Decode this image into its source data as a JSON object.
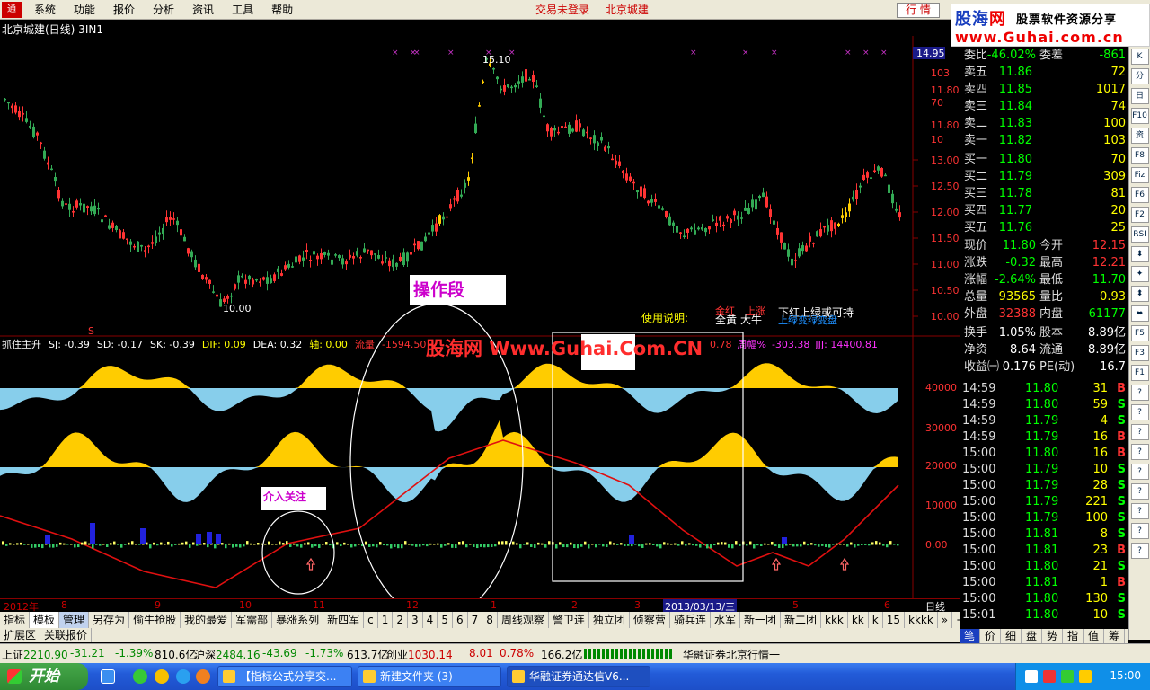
{
  "menu": {
    "logo_text": "通",
    "items": [
      "系统",
      "功能",
      "报价",
      "分析",
      "资讯",
      "工具",
      "帮助"
    ],
    "status_left": "交易未登录",
    "status_right": "北京城建",
    "market_btn": "行 情"
  },
  "brand": {
    "name_a": "股海",
    "name_b": "网",
    "slogan": "股票软件资源分享",
    "url": "www.Guhai.com.cn"
  },
  "chart": {
    "title": "北京城建(日线) 3IN1",
    "high_label": "15.10",
    "low_label": "10.00",
    "signal_s": "S",
    "price_ticks": [
      "13.00",
      "12.50",
      "12.00",
      "11.50",
      "11.00",
      "10.50",
      "10.00"
    ],
    "price_box": "14.95",
    "vol_ticks": [
      "40000",
      "30000",
      "20000",
      "10000",
      "0.00"
    ],
    "indicator_line": [
      {
        "text": "抓住主升",
        "color": "#ffffff"
      },
      {
        "text": "SJ: -0.39",
        "color": "#ffffff"
      },
      {
        "text": "SD: -0.17",
        "color": "#ffffff"
      },
      {
        "text": "SK: -0.39",
        "color": "#ffffff"
      },
      {
        "text": "DIF: 0.09",
        "color": "#ffff00"
      },
      {
        "text": "DEA: 0.32",
        "color": "#ffffff"
      },
      {
        "text": "轴: 0.00",
        "color": "#ffff00"
      },
      {
        "text": "流量",
        "color": "#ff3333"
      },
      {
        "text": "-1594.50",
        "color": "#ff3333"
      }
    ],
    "indicator_tail": [
      {
        "text": "0.78",
        "color": "#ff3333"
      },
      {
        "text": "周幅%",
        "color": "#ff33ff"
      },
      {
        "text": "-303.38",
        "color": "#ff33ff"
      },
      {
        "text": "JJJ: 14400.81",
        "color": "#ff33ff"
      }
    ],
    "usage_label": "使用说明:",
    "usage_tokens": [
      "金红",
      "上涨",
      "全黄",
      "大牛"
    ],
    "usage_note1": "下红上绿或可持",
    "usage_note2": "上绿变绿变盘"
  },
  "overlays": {
    "watermark": "股海网 Www.Guhai.Com.CN",
    "op_segment": "操作段",
    "attention": "介入关注",
    "no_op": "不做"
  },
  "date_axis": {
    "year": "2012年",
    "months": [
      "8",
      "9",
      "10",
      "11",
      "12",
      "1",
      "2",
      "3",
      "5",
      "6"
    ],
    "selected_date": "2013/03/13/三",
    "period": "日线"
  },
  "tabs": [
    "指标",
    "模板",
    "管理",
    "另存为",
    "偷牛抢股",
    "我的最爱",
    "军需部",
    "暴涨系列",
    "新四军",
    "c",
    "1",
    "2",
    "3",
    "4",
    "5",
    "6",
    "7",
    "8",
    "周线观察",
    "警卫连",
    "独立团",
    "侦察营",
    "骑兵连",
    "水军",
    "新一团",
    "新二团",
    "kkk",
    "kk",
    "k",
    "15",
    "kkkk",
    "»",
    "+",
    "-",
    "0"
  ],
  "subtabs": [
    "扩展区",
    "关联报价"
  ],
  "quote": {
    "ratio_label": "委比",
    "ratio_value": "-46.02%",
    "diff_label": "委差",
    "diff_value": "-861",
    "asks": [
      {
        "label": "卖五",
        "price": "11.86",
        "vol": "72"
      },
      {
        "label": "卖四",
        "price": "11.85",
        "vol": "1017"
      },
      {
        "label": "卖三",
        "price": "11.84",
        "vol": "74"
      },
      {
        "label": "卖二",
        "price": "11.83",
        "vol": "100"
      },
      {
        "label": "卖一",
        "price": "11.82",
        "vol": "103"
      }
    ],
    "bids": [
      {
        "label": "买一",
        "price": "11.80",
        "vol": "70"
      },
      {
        "label": "买二",
        "price": "11.79",
        "vol": "309"
      },
      {
        "label": "买三",
        "price": "11.78",
        "vol": "81"
      },
      {
        "label": "买四",
        "price": "11.77",
        "vol": "20"
      },
      {
        "label": "买五",
        "price": "11.76",
        "vol": "25"
      }
    ],
    "stats": [
      {
        "l1": "现价",
        "v1": "11.80",
        "c1": "#00ff00",
        "l2": "今开",
        "v2": "12.15",
        "c2": "#ff3333"
      },
      {
        "l1": "涨跌",
        "v1": "-0.32",
        "c1": "#00ff00",
        "l2": "最高",
        "v2": "12.21",
        "c2": "#ff3333"
      },
      {
        "l1": "涨幅",
        "v1": "-2.64%",
        "c1": "#00ff00",
        "l2": "最低",
        "v2": "11.70",
        "c2": "#00ff00"
      },
      {
        "l1": "总量",
        "v1": "93565",
        "c1": "#ffff00",
        "l2": "量比",
        "v2": "0.93",
        "c2": "#ffff00"
      },
      {
        "l1": "外盘",
        "v1": "32388",
        "c1": "#ff3333",
        "l2": "内盘",
        "v2": "61177",
        "c2": "#00ff00"
      },
      {
        "l1": "换手",
        "v1": "1.05%",
        "c1": "#ffffff",
        "l2": "股本",
        "v2": "8.89亿",
        "c2": "#ffffff"
      },
      {
        "l1": "净资",
        "v1": "8.64",
        "c1": "#ffffff",
        "l2": "流通",
        "v2": "8.89亿",
        "c2": "#ffffff"
      },
      {
        "l1": "收益㈠",
        "v1": "0.176",
        "c1": "#ffffff",
        "l2": "PE(动)",
        "v2": "16.7",
        "c2": "#ffffff"
      }
    ],
    "ticks": [
      {
        "t": "14:59",
        "p": "11.80",
        "v": "31",
        "f": "B"
      },
      {
        "t": "14:59",
        "p": "11.80",
        "v": "59",
        "f": "S"
      },
      {
        "t": "14:59",
        "p": "11.79",
        "v": "4",
        "f": "S"
      },
      {
        "t": "14:59",
        "p": "11.79",
        "v": "16",
        "f": "B"
      },
      {
        "t": "15:00",
        "p": "11.80",
        "v": "16",
        "f": "B"
      },
      {
        "t": "15:00",
        "p": "11.79",
        "v": "10",
        "f": "S"
      },
      {
        "t": "15:00",
        "p": "11.79",
        "v": "28",
        "f": "S"
      },
      {
        "t": "15:00",
        "p": "11.79",
        "v": "221",
        "f": "S"
      },
      {
        "t": "15:00",
        "p": "11.79",
        "v": "100",
        "f": "S"
      },
      {
        "t": "15:00",
        "p": "11.81",
        "v": "8",
        "f": "S"
      },
      {
        "t": "15:00",
        "p": "11.81",
        "v": "23",
        "f": "B"
      },
      {
        "t": "15:00",
        "p": "11.80",
        "v": "21",
        "f": "S"
      },
      {
        "t": "15:00",
        "p": "11.81",
        "v": "1",
        "f": "B"
      },
      {
        "t": "15:00",
        "p": "11.80",
        "v": "130",
        "f": "S"
      },
      {
        "t": "15:01",
        "p": "11.80",
        "v": "10",
        "f": "S"
      }
    ],
    "tabs": [
      "笔",
      "价",
      "细",
      "盘",
      "势",
      "指",
      "值",
      "筹"
    ]
  },
  "side_tools": [
    "K",
    "分",
    "日",
    "F10",
    "资",
    "F8",
    "Fiz",
    "F6",
    "F2",
    "RSI",
    "⬍",
    "✦",
    "⬍",
    "⬌",
    "F5",
    "F3",
    "F1",
    "?",
    "?",
    "?",
    "?",
    "?",
    "?",
    "?",
    "?",
    "?",
    "?",
    "?",
    "?",
    "?"
  ],
  "index_bar": [
    {
      "label": "上证",
      "value": "2210.90",
      "chg": "-31.21",
      "pct": "-1.39%",
      "amt": "810.6亿"
    },
    {
      "label": "沪深",
      "value": "2484.16",
      "chg": "-43.69",
      "pct": "-1.73%",
      "amt": "613.7亿"
    },
    {
      "label": "创业",
      "value": "1030.14",
      "chg": "8.01",
      "pct": "0.78%",
      "amt": "166.2亿"
    }
  ],
  "broker": "华融证券北京行情一",
  "taskbar": {
    "start": "开始",
    "tasks": [
      "【指标公式分享交...",
      "新建文件夹 (3)",
      "华融证券通达信V6..."
    ],
    "clock": "15:00"
  },
  "colors": {
    "up": "#ff3333",
    "down": "#00ff00",
    "bull": "#ffcc00",
    "bear": "#87ceeb",
    "grid_border": "#880000"
  }
}
